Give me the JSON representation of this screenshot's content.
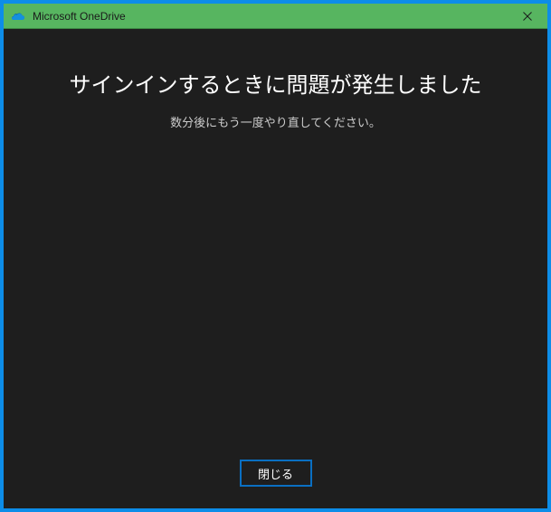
{
  "window": {
    "title": "Microsoft OneDrive"
  },
  "dialog": {
    "heading": "サインインするときに問題が発生しました",
    "subtext": "数分後にもう一度やり直してください。",
    "close_button_label": "閉じる"
  }
}
